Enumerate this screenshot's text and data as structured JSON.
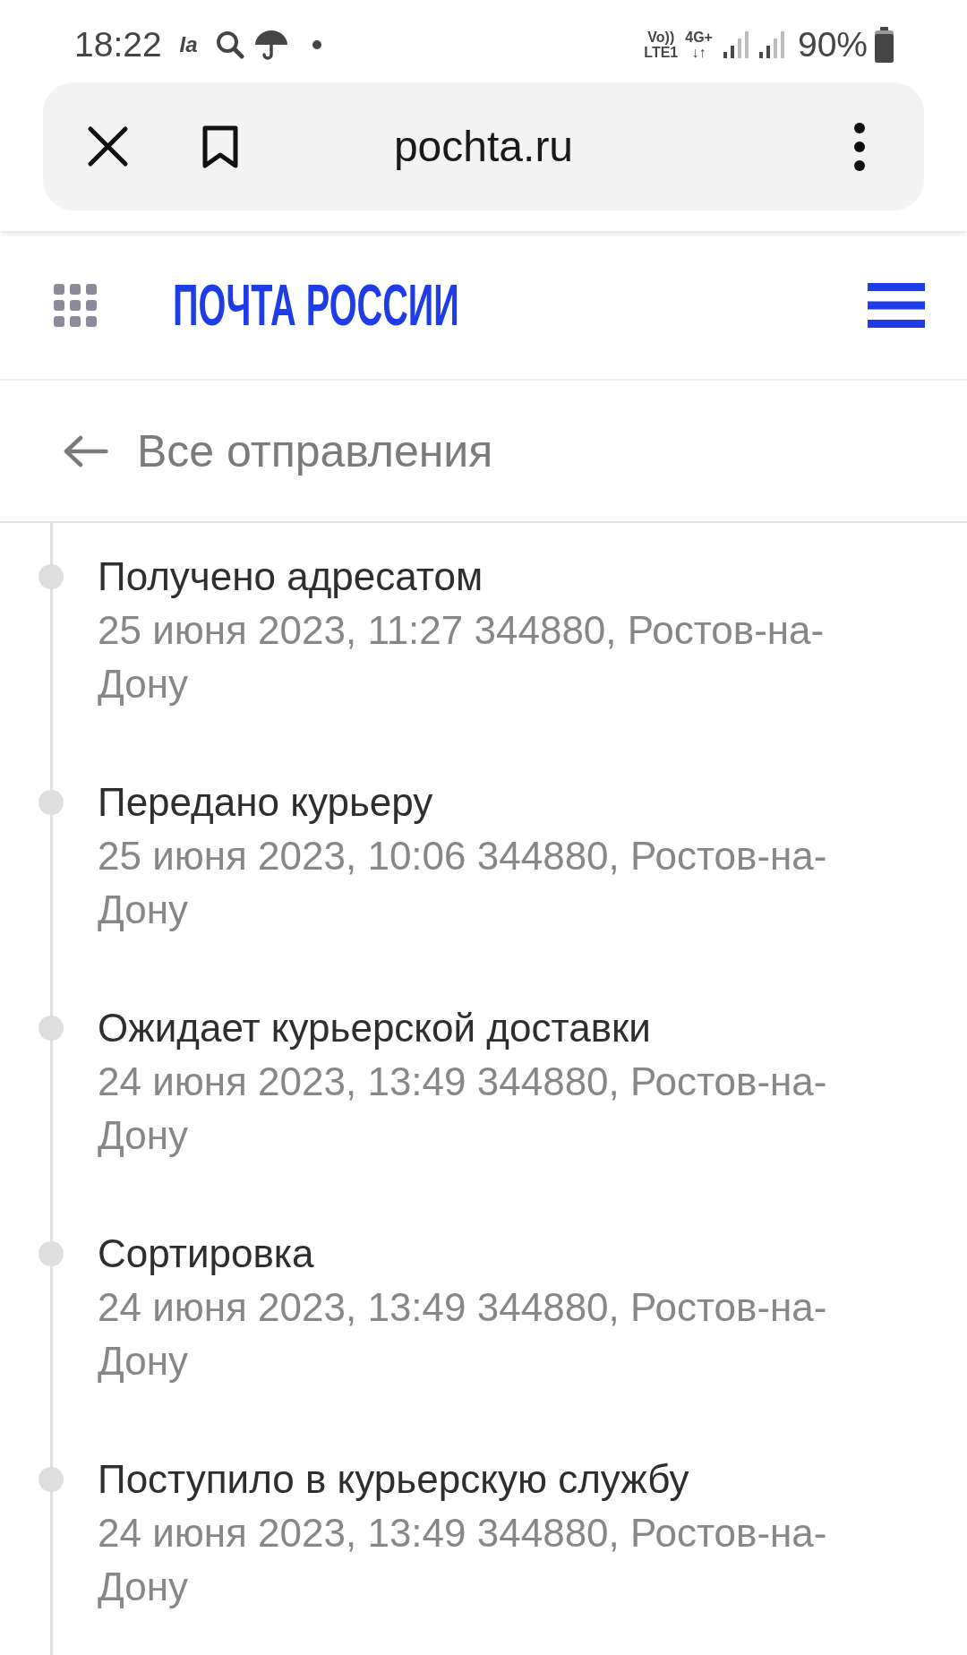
{
  "status_bar": {
    "time": "18:22",
    "app_label": "Ia",
    "volte": {
      "top": "Vo))",
      "bottom": "LTE1"
    },
    "network": {
      "type": "4G+",
      "arrows": "↓↑"
    },
    "battery": "90%"
  },
  "browser_bar": {
    "url": "pochta.ru"
  },
  "header": {
    "logo": "ПОЧТА РОССИИ"
  },
  "back_link": {
    "label": "Все отправления"
  },
  "timeline": [
    {
      "status": "Получено адресатом",
      "details": "25 июня 2023, 11:27 344880, Ростов-на-Дону"
    },
    {
      "status": "Передано курьеру",
      "details": "25 июня 2023, 10:06 344880, Ростов-на-Дону"
    },
    {
      "status": "Ожидает курьерской доставки",
      "details": "24 июня 2023, 13:49 344880, Ростов-на-Дону"
    },
    {
      "status": "Сортировка",
      "details": "24 июня 2023, 13:49 344880, Ростов-на-Дону"
    },
    {
      "status": "Поступило в курьерскую службу",
      "details": "24 июня 2023, 13:49 344880, Ростов-на-Дону"
    }
  ]
}
